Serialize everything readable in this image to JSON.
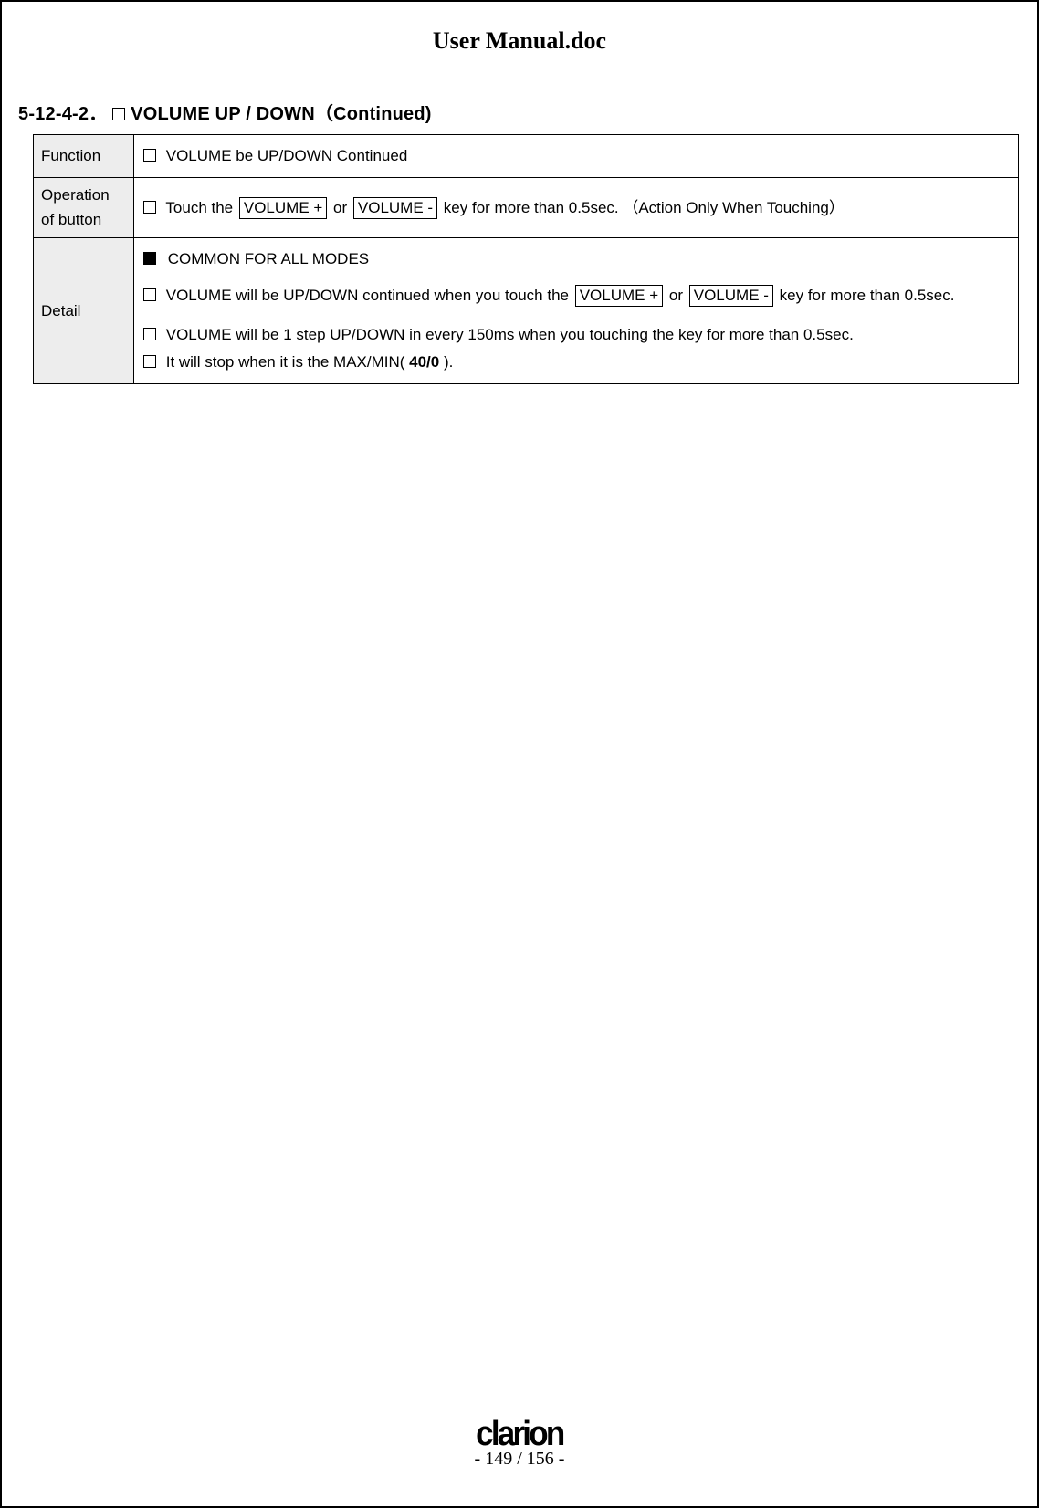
{
  "doc_title": "User Manual.doc",
  "section": {
    "number": "5-12-4-2．",
    "title": "VOLUME UP / DOWN（Continued)"
  },
  "rows": {
    "function": {
      "label": "Function",
      "text": "VOLUME be UP/DOWN Continued"
    },
    "operation": {
      "label_line1": "Operation",
      "label_line2": "of button",
      "pre": "Touch the ",
      "key1": "VOLUME +",
      "mid": " or ",
      "key2": "VOLUME -",
      "post": " key for more than 0.5sec. （Action Only When Touching）"
    },
    "detail": {
      "label": "Detail",
      "common": "COMMON FOR ALL MODES",
      "line1_pre": "VOLUME will be UP/DOWN continued when you touch the ",
      "line1_key1": "VOLUME +",
      "line1_mid": " or ",
      "line1_key2": "VOLUME  -",
      "line1_post": " key for more than 0.5sec.",
      "line2": "VOLUME will be 1 step UP/DOWN in every 150ms when you touching the key for more than 0.5sec.",
      "line3_pre": "It will stop when it is the MAX/MIN( ",
      "line3_bold": "40/0",
      "line3_post": " )."
    }
  },
  "footer": {
    "brand": "clarion",
    "page_cur": "149",
    "page_total": "156"
  }
}
